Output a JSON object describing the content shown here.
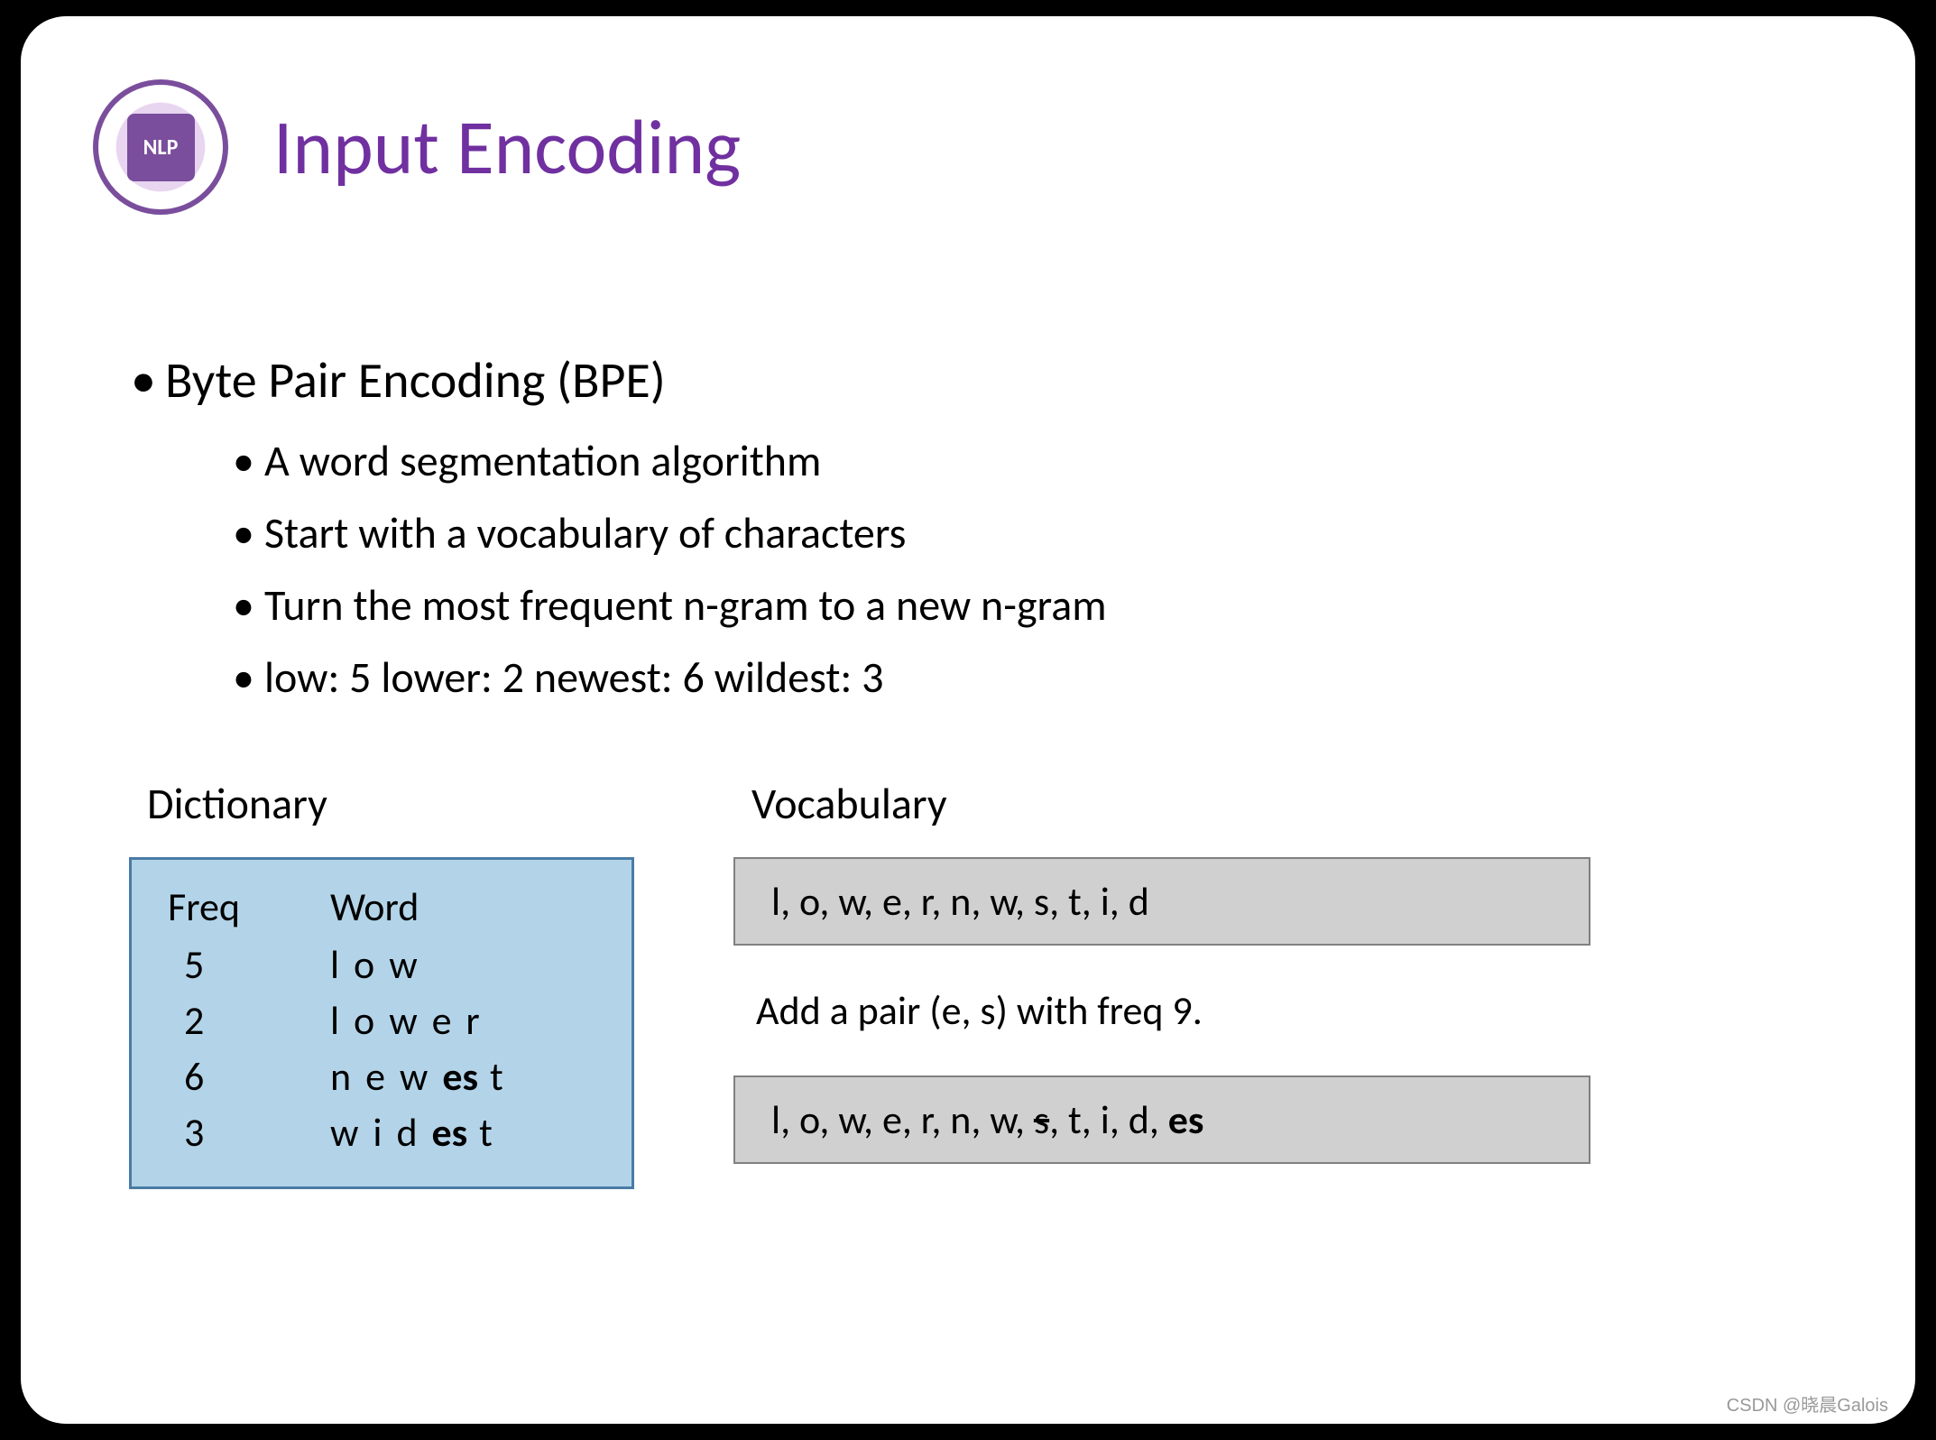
{
  "title": "Input Encoding",
  "bullet_main": "Byte Pair Encoding (BPE)",
  "bullets": [
    "A word segmentation algorithm",
    "Start with a vocabulary of characters",
    "Turn the most frequent n-gram to a new n-gram",
    "low: 5 lower: 2 newest: 6 wildest: 3"
  ],
  "dict_label": "Dictionary",
  "dict_headers": {
    "freq": "Freq",
    "word": "Word"
  },
  "dict_rows": [
    {
      "freq": "5",
      "word_pre": "l o w",
      "word_bold": "",
      "word_post": ""
    },
    {
      "freq": "2",
      "word_pre": "l o w e r",
      "word_bold": "",
      "word_post": ""
    },
    {
      "freq": "6",
      "word_pre": "n e w ",
      "word_bold": "es",
      "word_post": " t"
    },
    {
      "freq": "3",
      "word_pre": "w i d ",
      "word_bold": "es",
      "word_post": " t"
    }
  ],
  "vocab_label": "Vocabulary",
  "vocab_box1": "l, o, w, e, r, n, w, s, t, i, d",
  "add_text": "Add a pair (e, s) with freq 9.",
  "vocab_box2_pre": "l, o, w, e, r, n, w, ",
  "vocab_box2_strike": "s",
  "vocab_box2_mid": ", t, i, d, ",
  "vocab_box2_bold": "es",
  "watermark": "CSDN @晓晨Galois"
}
